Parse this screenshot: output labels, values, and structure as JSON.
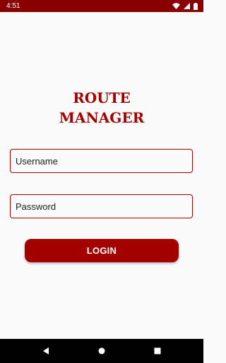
{
  "status_bar": {
    "time": "4:51",
    "icons": [
      "wifi-icon",
      "signal-icon",
      "battery-icon"
    ]
  },
  "app": {
    "title_line1": "ROUTE",
    "title_line2": "MANAGER"
  },
  "form": {
    "username_placeholder": "Username",
    "username_value": "",
    "password_placeholder": "Password",
    "password_value": "",
    "login_label": "LOGIN"
  },
  "nav_bar": {
    "icons": [
      "back-icon",
      "home-icon",
      "recents-icon"
    ]
  },
  "colors": {
    "status_bar": "#8a0000",
    "accent": "#a30000",
    "background": "#fafafa",
    "nav_bar": "#000000"
  }
}
